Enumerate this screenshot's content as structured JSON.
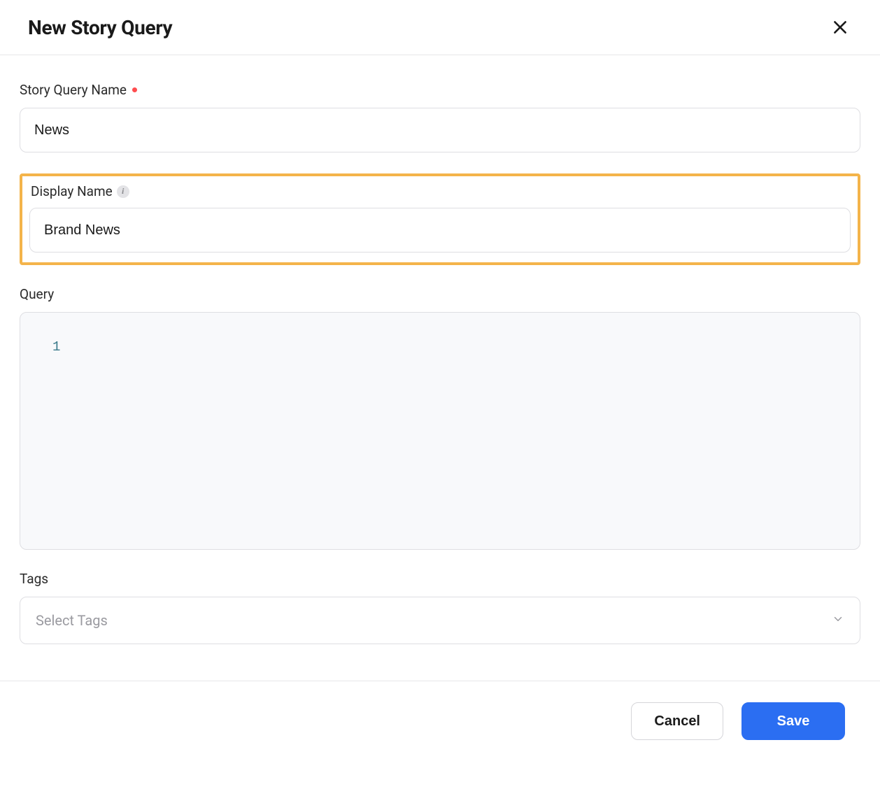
{
  "header": {
    "title": "New Story Query"
  },
  "fields": {
    "storyQueryName": {
      "label": "Story Query Name",
      "value": "News",
      "required": true
    },
    "displayName": {
      "label": "Display Name",
      "value": "Brand News",
      "hasInfo": true
    },
    "query": {
      "label": "Query",
      "lineNumber": "1",
      "value": ""
    },
    "tags": {
      "label": "Tags",
      "placeholder": "Select Tags"
    }
  },
  "footer": {
    "cancel": "Cancel",
    "save": "Save"
  }
}
